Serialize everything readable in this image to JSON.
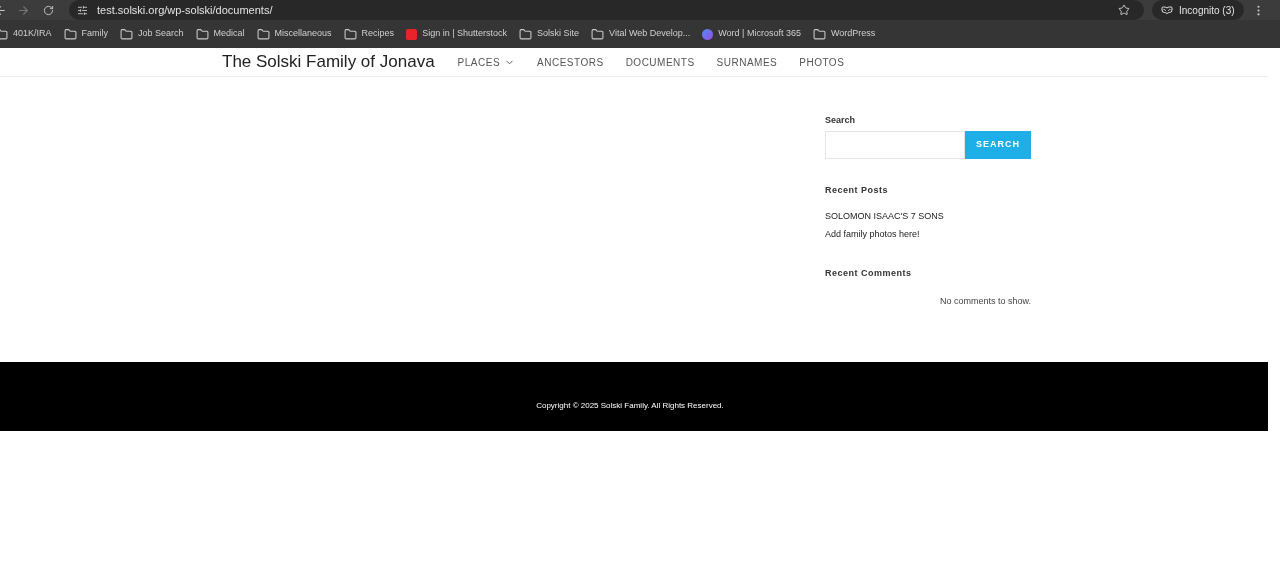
{
  "browser": {
    "url": "test.solski.org/wp-solski/documents/",
    "profile": "Incognito (3)",
    "bookmarks": [
      {
        "label": "401K/IRA",
        "kind": "folder"
      },
      {
        "label": "Family",
        "kind": "folder"
      },
      {
        "label": "Job Search",
        "kind": "folder"
      },
      {
        "label": "Medical",
        "kind": "folder"
      },
      {
        "label": "Miscellaneous",
        "kind": "folder"
      },
      {
        "label": "Recipes",
        "kind": "folder"
      },
      {
        "label": "Sign in | Shutterstock",
        "kind": "shutterstock"
      },
      {
        "label": "Solski Site",
        "kind": "folder"
      },
      {
        "label": "Vital Web Develop...",
        "kind": "folder"
      },
      {
        "label": "Word | Microsoft 365",
        "kind": "word"
      },
      {
        "label": "WordPress",
        "kind": "folder"
      }
    ]
  },
  "site": {
    "title": "The Solski Family of Jonava",
    "nav": [
      {
        "label": "PLACES",
        "dropdown": true
      },
      {
        "label": "ANCESTORS",
        "dropdown": false
      },
      {
        "label": "DOCUMENTS",
        "dropdown": false
      },
      {
        "label": "SURNAMES",
        "dropdown": false
      },
      {
        "label": "PHOTOS",
        "dropdown": false
      }
    ]
  },
  "sidebar": {
    "search_label": "Search",
    "search_button": "SEARCH",
    "recent_posts": {
      "heading": "Recent Posts",
      "items": [
        "SOLOMON ISAAC'S 7 SONS",
        "Add family photos here!"
      ]
    },
    "recent_comments": {
      "heading": "Recent Comments",
      "empty": "No comments to show."
    }
  },
  "footer": {
    "copyright": "Copyright © 2025 Solski Family. All Rights Reserved."
  }
}
